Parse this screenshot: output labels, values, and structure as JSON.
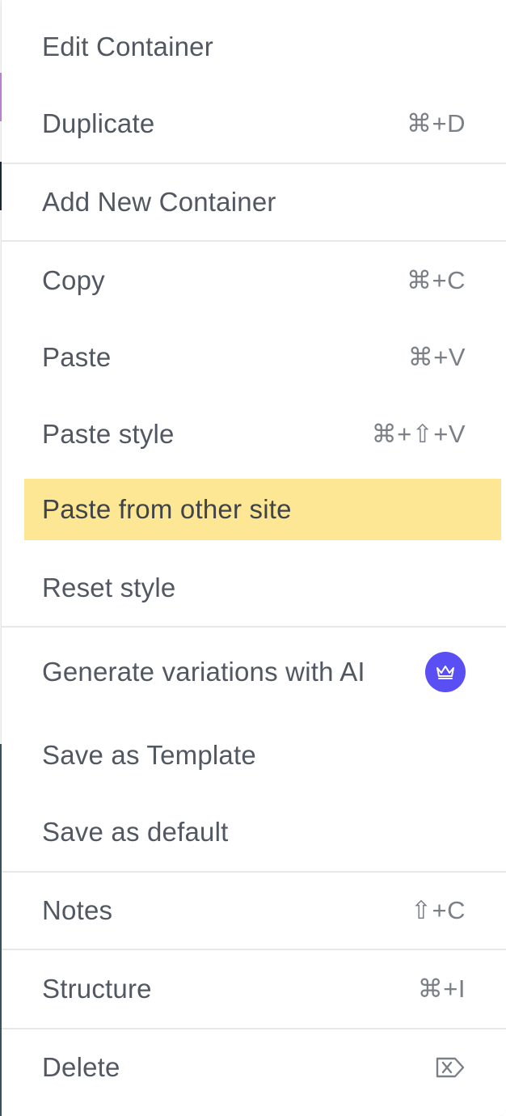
{
  "colors": {
    "text": "#525861",
    "shortcut": "#7b8088",
    "highlight": "#fde795",
    "divider": "#e6e8eb",
    "premium_badge": "#5a4ff3"
  },
  "menu": {
    "items": [
      {
        "label": "Edit Container",
        "shortcut": ""
      },
      {
        "label": "Duplicate",
        "shortcut": "⌘+D"
      },
      {
        "label": "Add New Container",
        "shortcut": ""
      },
      {
        "label": "Copy",
        "shortcut": "⌘+C"
      },
      {
        "label": "Paste",
        "shortcut": "⌘+V"
      },
      {
        "label": "Paste style",
        "shortcut": "⌘+⇧+V"
      },
      {
        "label": "Paste from other site",
        "shortcut": "",
        "highlighted": true
      },
      {
        "label": "Reset style",
        "shortcut": ""
      },
      {
        "label": "Generate variations with AI",
        "shortcut": "",
        "icon": "crown-icon"
      },
      {
        "label": "Save as Template",
        "shortcut": ""
      },
      {
        "label": "Save as default",
        "shortcut": ""
      },
      {
        "label": "Notes",
        "shortcut": "⇧+C"
      },
      {
        "label": "Structure",
        "shortcut": "⌘+I"
      },
      {
        "label": "Delete",
        "shortcut": "",
        "icon": "delete-key-icon"
      }
    ]
  }
}
